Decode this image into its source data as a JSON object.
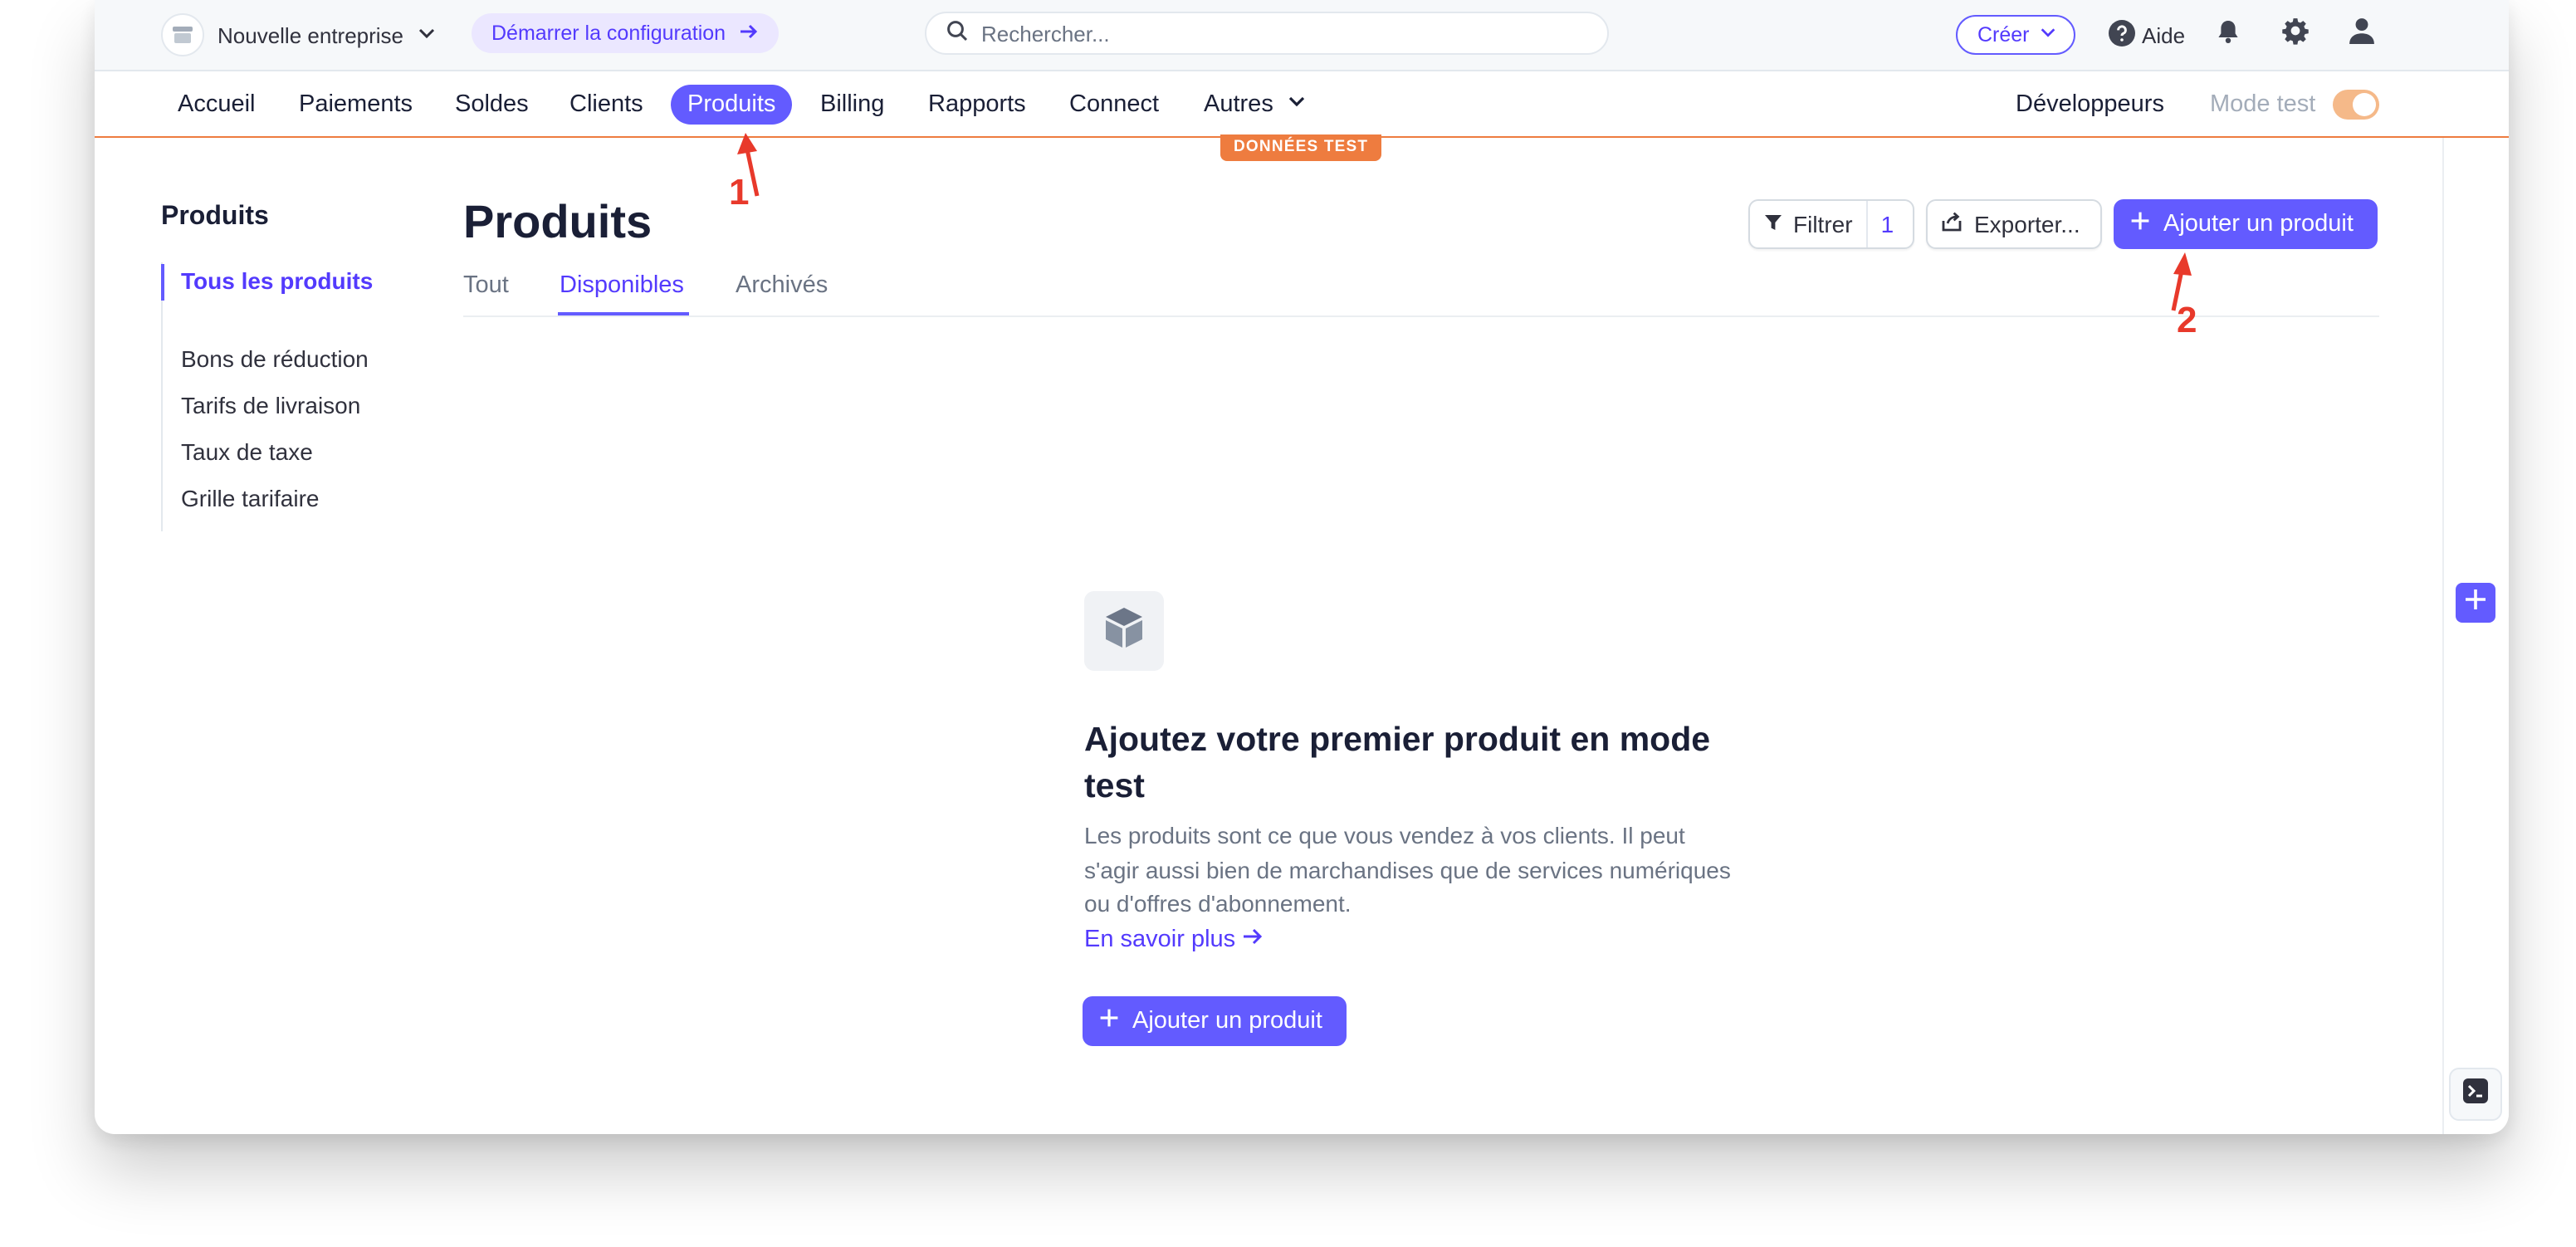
{
  "topbar": {
    "account_name": "Nouvelle entreprise",
    "setup_label": "Démarrer la configuration",
    "search_placeholder": "Rechercher...",
    "create_label": "Créer",
    "help_label": "Aide"
  },
  "nav": {
    "items": [
      "Accueil",
      "Paiements",
      "Soldes",
      "Clients",
      "Produits",
      "Billing",
      "Rapports",
      "Connect",
      "Autres"
    ],
    "active": "Produits",
    "developers_label": "Développeurs",
    "test_mode_label": "Mode test",
    "test_mode_on": true
  },
  "test_badge": "DONNÉES TEST",
  "sidebar": {
    "title": "Produits",
    "items": [
      "Tous les produits",
      "Bons de réduction",
      "Tarifs de livraison",
      "Taux de taxe",
      "Grille tarifaire"
    ],
    "active": "Tous les produits"
  },
  "main": {
    "title": "Produits",
    "tabs": [
      "Tout",
      "Disponibles",
      "Archivés"
    ],
    "active_tab": "Disponibles",
    "filter_label": "Filtrer",
    "filter_count": "1",
    "export_label": "Exporter...",
    "add_product_label": "Ajouter un produit"
  },
  "empty_state": {
    "title": "Ajoutez votre premier produit en mode test",
    "description": "Les produits sont ce que vous vendez à vos clients. Il peut s'agir aussi bien de marchandises que de services numériques ou d'offres d'abonnement.",
    "learn_more": "En savoir plus",
    "cta_label": "Ajouter un produit"
  },
  "annotations": [
    "1",
    "2"
  ],
  "colors": {
    "accent": "#635bff",
    "test_orange": "#ee7c3f",
    "annotation_red": "#e8392b"
  }
}
